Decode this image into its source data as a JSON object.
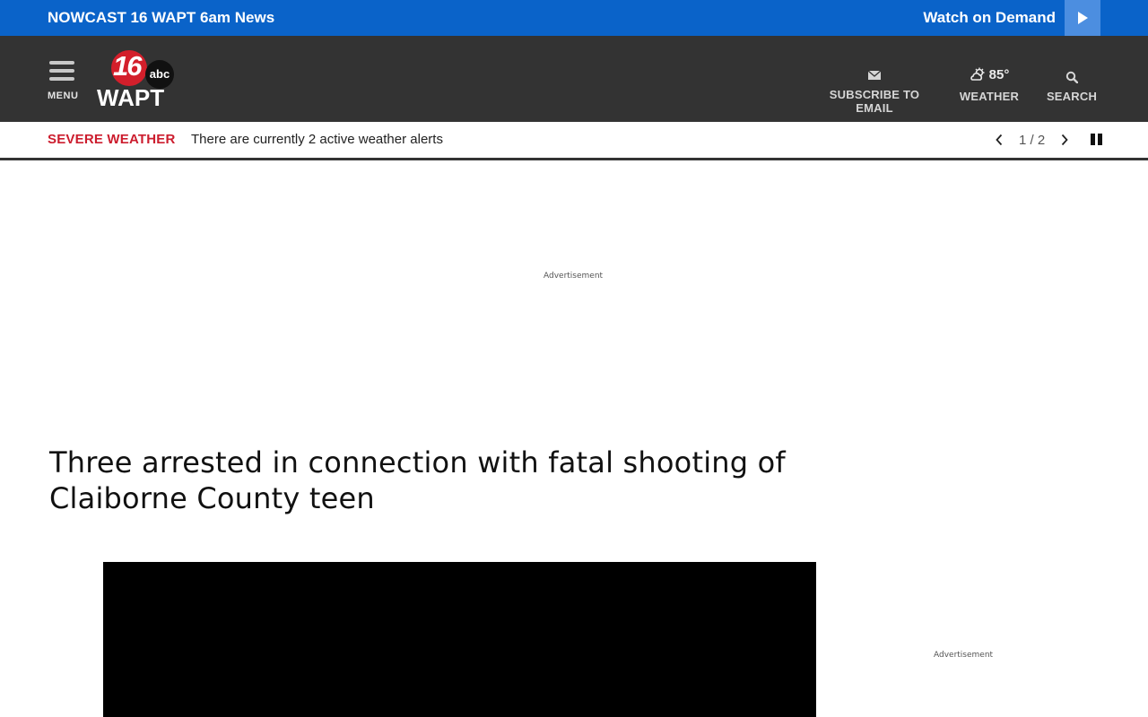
{
  "topbar": {
    "nowcast": "NOWCAST 16 WAPT 6am News",
    "watch_on_demand": "Watch on Demand",
    "colors": {
      "background": "#0a63c9",
      "play_box": "#4c8ee0"
    }
  },
  "header": {
    "menu_label": "MENU",
    "logo": {
      "number": "16",
      "network": "abc",
      "station": "WAPT"
    },
    "subscribe_label": "SUBSCRIBE TO EMAIL",
    "weather_temp": "85°",
    "weather_label": "WEATHER",
    "search_label": "SEARCH",
    "colors": {
      "background": "#333333"
    }
  },
  "alert": {
    "category": "SEVERE WEATHER",
    "message": "There are currently 2 active weather alerts",
    "pager": "1 / 2",
    "colors": {
      "category": "#cc1d2e"
    }
  },
  "ads": {
    "top_label": "Advertisement",
    "side_label": "Advertisement"
  },
  "article": {
    "headline": "Three arrested in connection with fatal shooting of Claiborne County teen"
  },
  "icons": [
    "play-icon",
    "menu-icon",
    "email-icon",
    "weather-partly-cloudy-icon",
    "search-icon",
    "chevron-left-icon",
    "chevron-right-icon",
    "pause-icon"
  ]
}
